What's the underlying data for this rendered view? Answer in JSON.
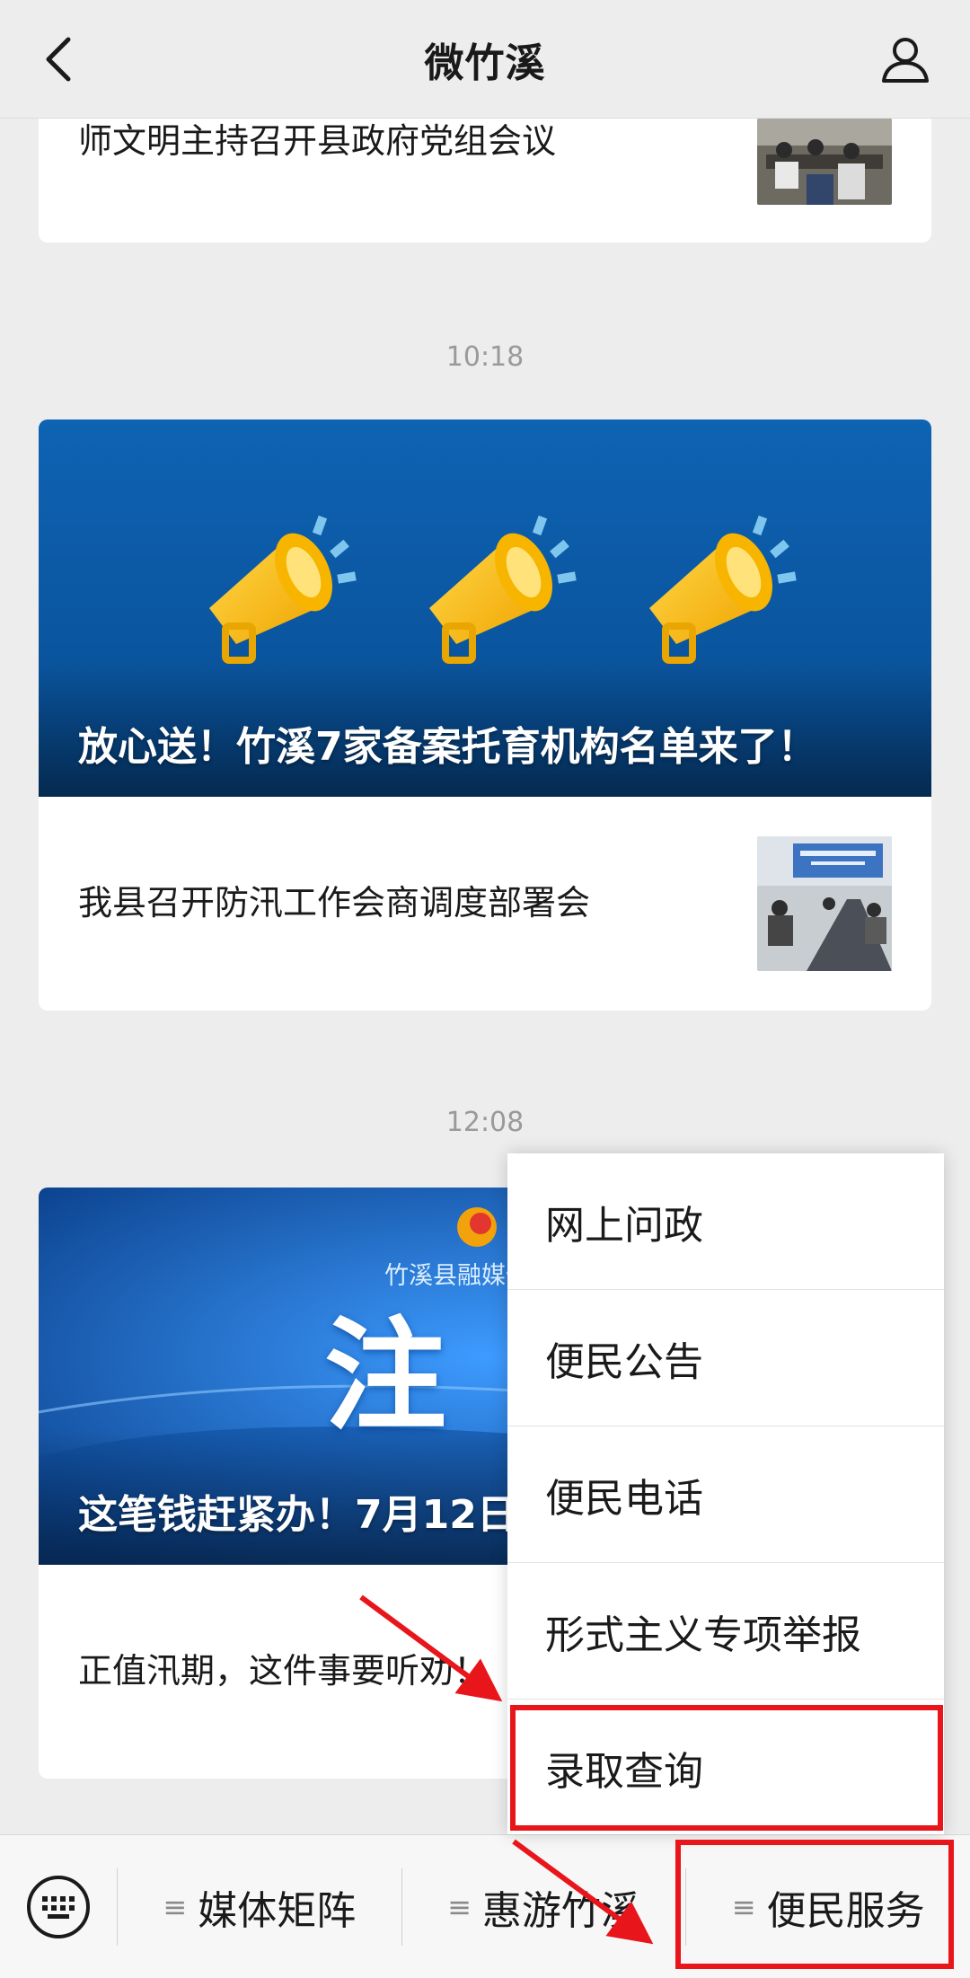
{
  "header": {
    "title": "微竹溪"
  },
  "feed": {
    "article1": {
      "title": "师文明主持召开县政府党组会议"
    },
    "time1": "10:18",
    "article2": {
      "cover_title": "放心送！竹溪7家备案托育机构名单来了！",
      "sub_title": "我县召开防汛工作会商调度部署会"
    },
    "time2": "12:08",
    "article3": {
      "cover_logo_text": "竹溪县融媒体",
      "cover_big_char": "注",
      "cover_title": "这笔钱赶紧办！7月12日",
      "sub_title": "正值汛期，这件事要听劝！"
    }
  },
  "popup_menu": {
    "items": [
      "网上问政",
      "便民公告",
      "便民电话",
      "形式主义专项举报",
      "录取查询"
    ]
  },
  "bottom_menu": {
    "items": [
      "媒体矩阵",
      "惠游竹溪",
      "便民服务"
    ]
  },
  "colors": {
    "background": "#ededed",
    "highlight": "#e8151b",
    "cover_blue": "#0b5aa6"
  }
}
